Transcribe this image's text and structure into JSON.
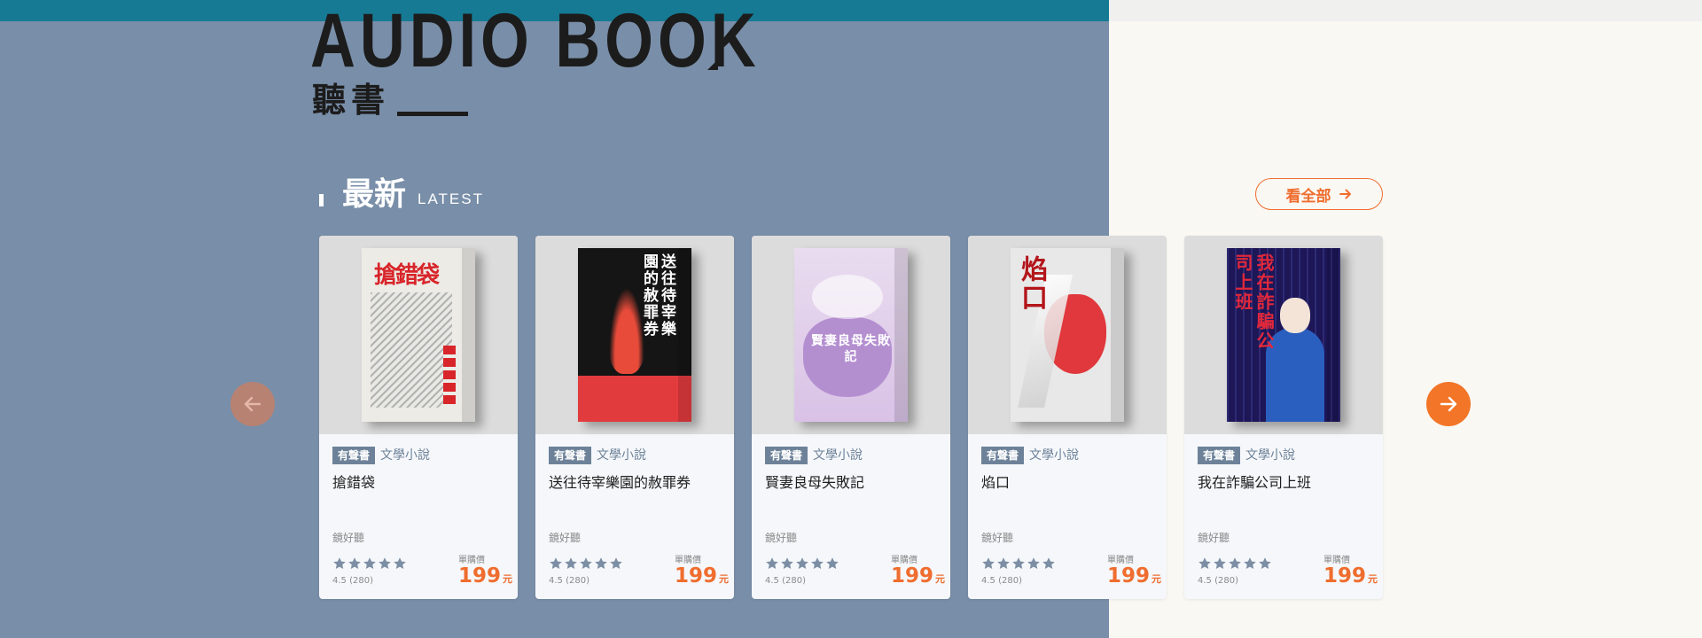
{
  "hero": {
    "title": "AUDIO BOOK",
    "subtitle": "聽書"
  },
  "section": {
    "title": "最新",
    "subtitle": "LATEST",
    "view_all_label": "看全部"
  },
  "colors": {
    "left_bg": "#798ea8",
    "right_bg": "#faf8f3",
    "teal_bar": "#167a94",
    "accent": "#ef6d2e",
    "badge_bg": "#6d8299"
  },
  "icons": {
    "prev": "arrow-left-icon",
    "next": "arrow-right-icon",
    "view_all": "arrow-right-icon",
    "star": "star-icon"
  },
  "books": [
    {
      "badge": "有聲書",
      "genre": "文學小說",
      "title": "搶錯袋",
      "publisher": "鏡好聽",
      "rating": "4.5 (280)",
      "price_label": "單購價",
      "price": "199",
      "unit": "元",
      "cover_text": "搶錯袋"
    },
    {
      "badge": "有聲書",
      "genre": "文學小說",
      "title": "送往待宰樂園的赦罪券",
      "publisher": "鏡好聽",
      "rating": "4.5 (280)",
      "price_label": "單購價",
      "price": "199",
      "unit": "元",
      "cover_text": "送往待宰樂園的赦罪券"
    },
    {
      "badge": "有聲書",
      "genre": "文學小說",
      "title": "賢妻良母失敗記",
      "publisher": "鏡好聽",
      "rating": "4.5 (280)",
      "price_label": "單購價",
      "price": "199",
      "unit": "元",
      "cover_text": "賢妻良母失敗記"
    },
    {
      "badge": "有聲書",
      "genre": "文學小說",
      "title": "焰口",
      "publisher": "鏡好聽",
      "rating": "4.5 (280)",
      "price_label": "單購價",
      "price": "199",
      "unit": "元",
      "cover_text": "焰口"
    },
    {
      "badge": "有聲書",
      "genre": "文學小說",
      "title": "我在詐騙公司上班",
      "publisher": "鏡好聽",
      "rating": "4.5 (280)",
      "price_label": "單購價",
      "price": "199",
      "unit": "元",
      "cover_text": "我在詐騙公司上班"
    }
  ]
}
